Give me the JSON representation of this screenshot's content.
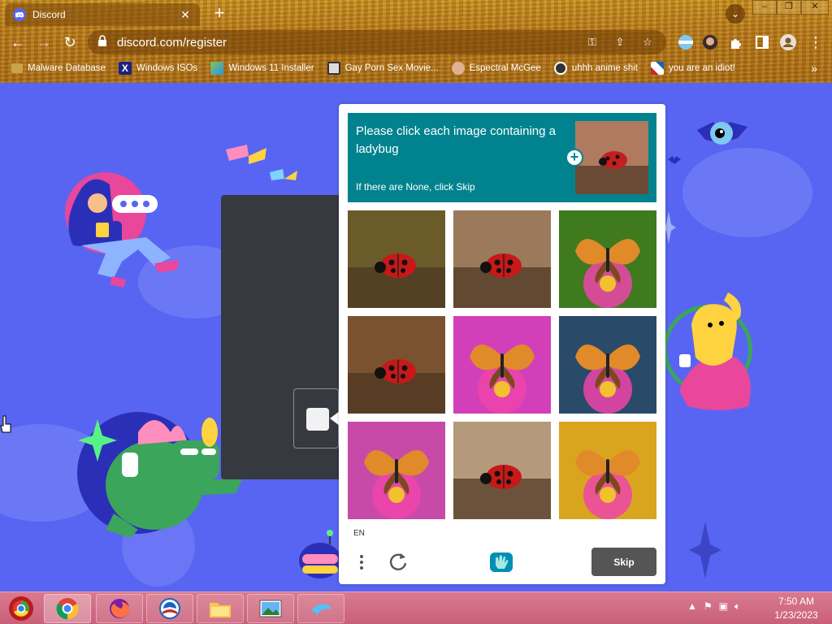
{
  "browser": {
    "tab_title": "Discord",
    "url": "discord.com/register",
    "bookmarks": [
      {
        "label": "Malware Database",
        "icon": "folder-icon"
      },
      {
        "label": "Windows ISOs",
        "icon": "x-logo-icon"
      },
      {
        "label": "Windows 11 Installer",
        "icon": "image-icon"
      },
      {
        "label": "Gay Porn Sex Movie...",
        "icon": "site-icon"
      },
      {
        "label": "Espectral McGee",
        "icon": "avatar-icon"
      },
      {
        "label": "uhhh anime shit",
        "icon": "anime-icon"
      },
      {
        "label": "you are an idiot!",
        "icon": "flag-icon"
      }
    ],
    "more_bookmarks": "»"
  },
  "captcha": {
    "question": "Please click each image containing a ladybug",
    "hint": "If there are None, click Skip",
    "language": "EN",
    "skip_label": "Skip",
    "tiles": [
      {
        "subject": "ladybug",
        "bg": "#6b5a2a"
      },
      {
        "subject": "ladybug",
        "bg": "#9a7a5a"
      },
      {
        "subject": "butterfly",
        "bg": "#3f7a1e"
      },
      {
        "subject": "ladybug",
        "bg": "#7a5230"
      },
      {
        "subject": "butterfly",
        "bg": "#d33fb8"
      },
      {
        "subject": "butterfly",
        "bg": "#2a4a6a"
      },
      {
        "subject": "butterfly",
        "bg": "#c84aa8"
      },
      {
        "subject": "ladybug",
        "bg": "#b49a7a"
      },
      {
        "subject": "butterfly",
        "bg": "#d9a51e"
      }
    ]
  },
  "taskbar": {
    "apps": [
      "chrome",
      "firefox",
      "obama",
      "explorer",
      "photos",
      "dolphin"
    ],
    "time": "7:50 AM",
    "date": "1/23/2023"
  },
  "colors": {
    "discord_blurple": "#5865f2",
    "captcha_teal": "#00838f",
    "taskbar_pink": "#d97a8f"
  }
}
